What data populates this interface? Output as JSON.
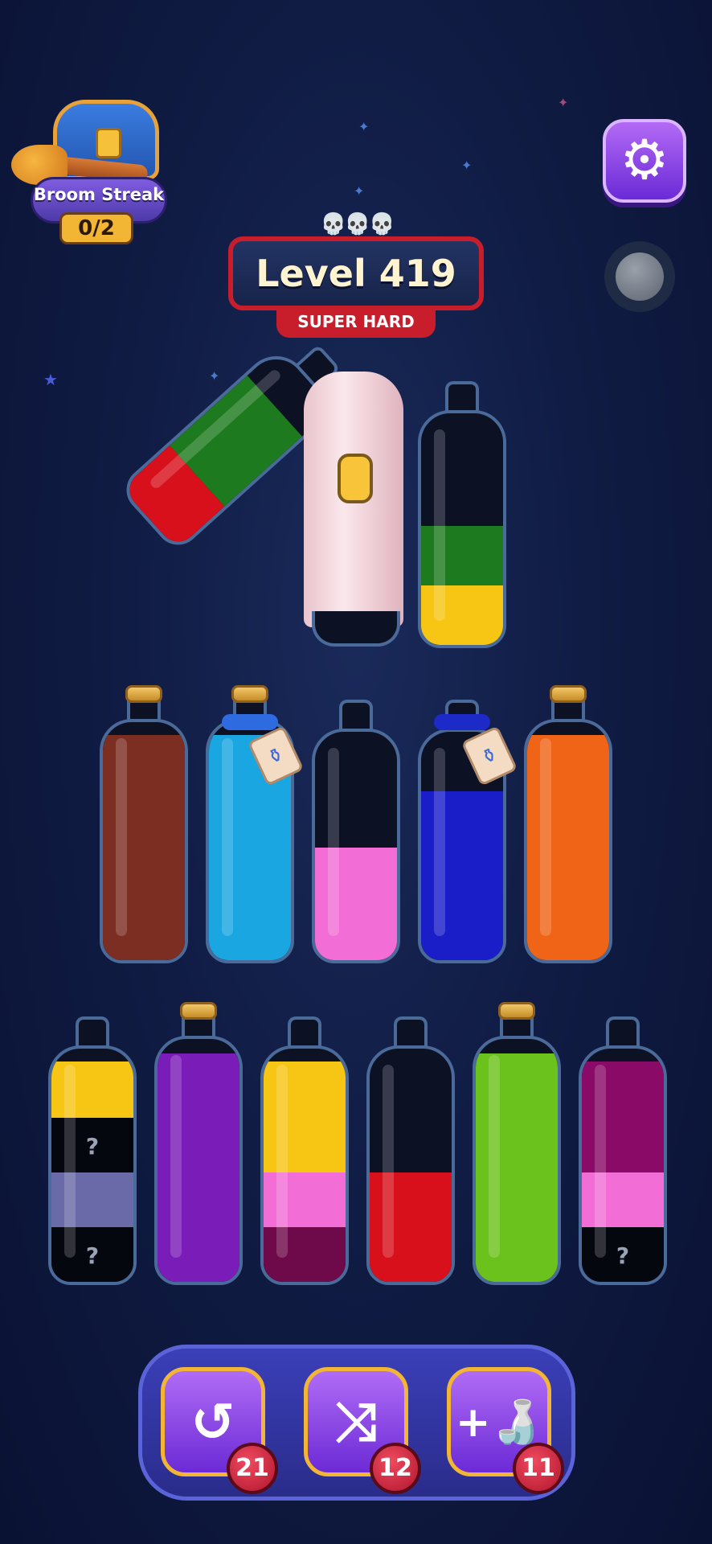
{
  "hud": {
    "broom_streak": {
      "label": "Broom Streak",
      "count": "0/2"
    },
    "level": {
      "title": "Level 419",
      "difficulty": "SUPER HARD"
    },
    "icons": {
      "settings": "gear-icon",
      "record": "record-icon",
      "skulls": "skull-icon"
    }
  },
  "colors": {
    "red": "#d8101c",
    "green": "#1e7a1e",
    "yellow": "#f7c615",
    "brown": "#7c2e22",
    "cyan": "#1aa6e0",
    "pink": "#f26ed6",
    "blue": "#1a1ec8",
    "orange": "#f06418",
    "slate": "#6a6aa8",
    "purple": "#7a1cb8",
    "maroon": "#6e0a4a",
    "lime": "#6cc21c",
    "magenta": "#8a0a68",
    "hidden": "#05070f"
  },
  "bottles": {
    "tilted": {
      "layers": [
        "red",
        "green"
      ]
    },
    "covered": {
      "state": "covered"
    },
    "top_right": {
      "layers": [
        "yellow",
        "green"
      ]
    },
    "row2": [
      {
        "layers": [
          "brown",
          "brown",
          "brown",
          "brown"
        ],
        "corked": true
      },
      {
        "layers": [
          "cyan",
          "cyan",
          "cyan",
          "cyan"
        ],
        "corked": true,
        "tagged": true
      },
      {
        "layers": [
          "pink"
        ],
        "corked": false
      },
      {
        "layers": [
          "blue",
          "blue",
          "blue"
        ],
        "corked": false,
        "tagged": true
      },
      {
        "layers": [
          "orange",
          "orange",
          "orange",
          "orange"
        ],
        "corked": true
      }
    ],
    "row3": [
      {
        "layers": [
          "hidden",
          "slate",
          "hidden",
          "yellow"
        ],
        "mystery_marker": "?"
      },
      {
        "layers": [
          "purple",
          "purple",
          "purple",
          "purple"
        ],
        "corked": true
      },
      {
        "layers": [
          "maroon",
          "pink",
          "yellow",
          "yellow"
        ]
      },
      {
        "layers": [
          "red",
          "red"
        ]
      },
      {
        "layers": [
          "lime",
          "lime",
          "lime",
          "lime"
        ],
        "corked": true
      },
      {
        "layers": [
          "hidden",
          "pink",
          "magenta",
          "magenta"
        ],
        "mystery_marker": "?"
      }
    ]
  },
  "tools": [
    {
      "name": "undo",
      "icon": "undo-icon",
      "count": "21"
    },
    {
      "name": "shuffle",
      "icon": "shuffle-icon",
      "count": "12"
    },
    {
      "name": "add-bottle",
      "icon": "add-bottle-icon",
      "count": "11"
    }
  ]
}
